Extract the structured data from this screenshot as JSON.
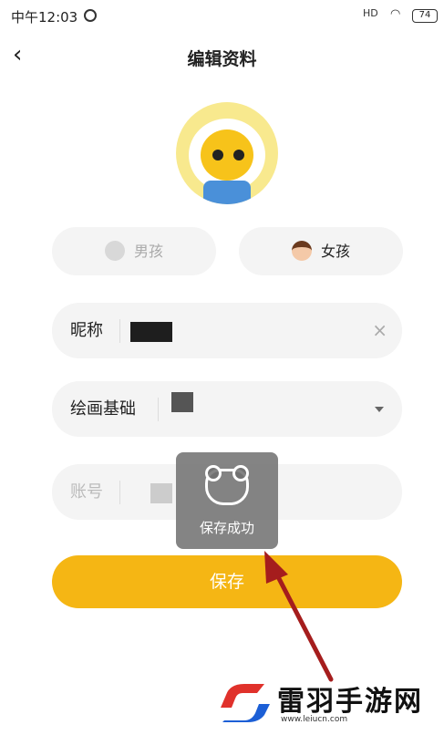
{
  "status_bar": {
    "time": "中午12:03",
    "battery": "74",
    "signal": "HD"
  },
  "header": {
    "title": "编辑资料"
  },
  "gender": {
    "boy_label": "男孩",
    "girl_label": "女孩"
  },
  "form": {
    "nickname_label": "昵称",
    "drawing_label": "绘画基础",
    "account_label": "账号"
  },
  "save_button": {
    "label": "保存"
  },
  "toast": {
    "message": "保存成功"
  },
  "watermark": {
    "name": "雷羽手游网",
    "url": "www.leiucn.com"
  },
  "colors": {
    "accent": "#f5b614",
    "field_bg": "#f4f4f4",
    "arrow": "#a51d1d"
  }
}
